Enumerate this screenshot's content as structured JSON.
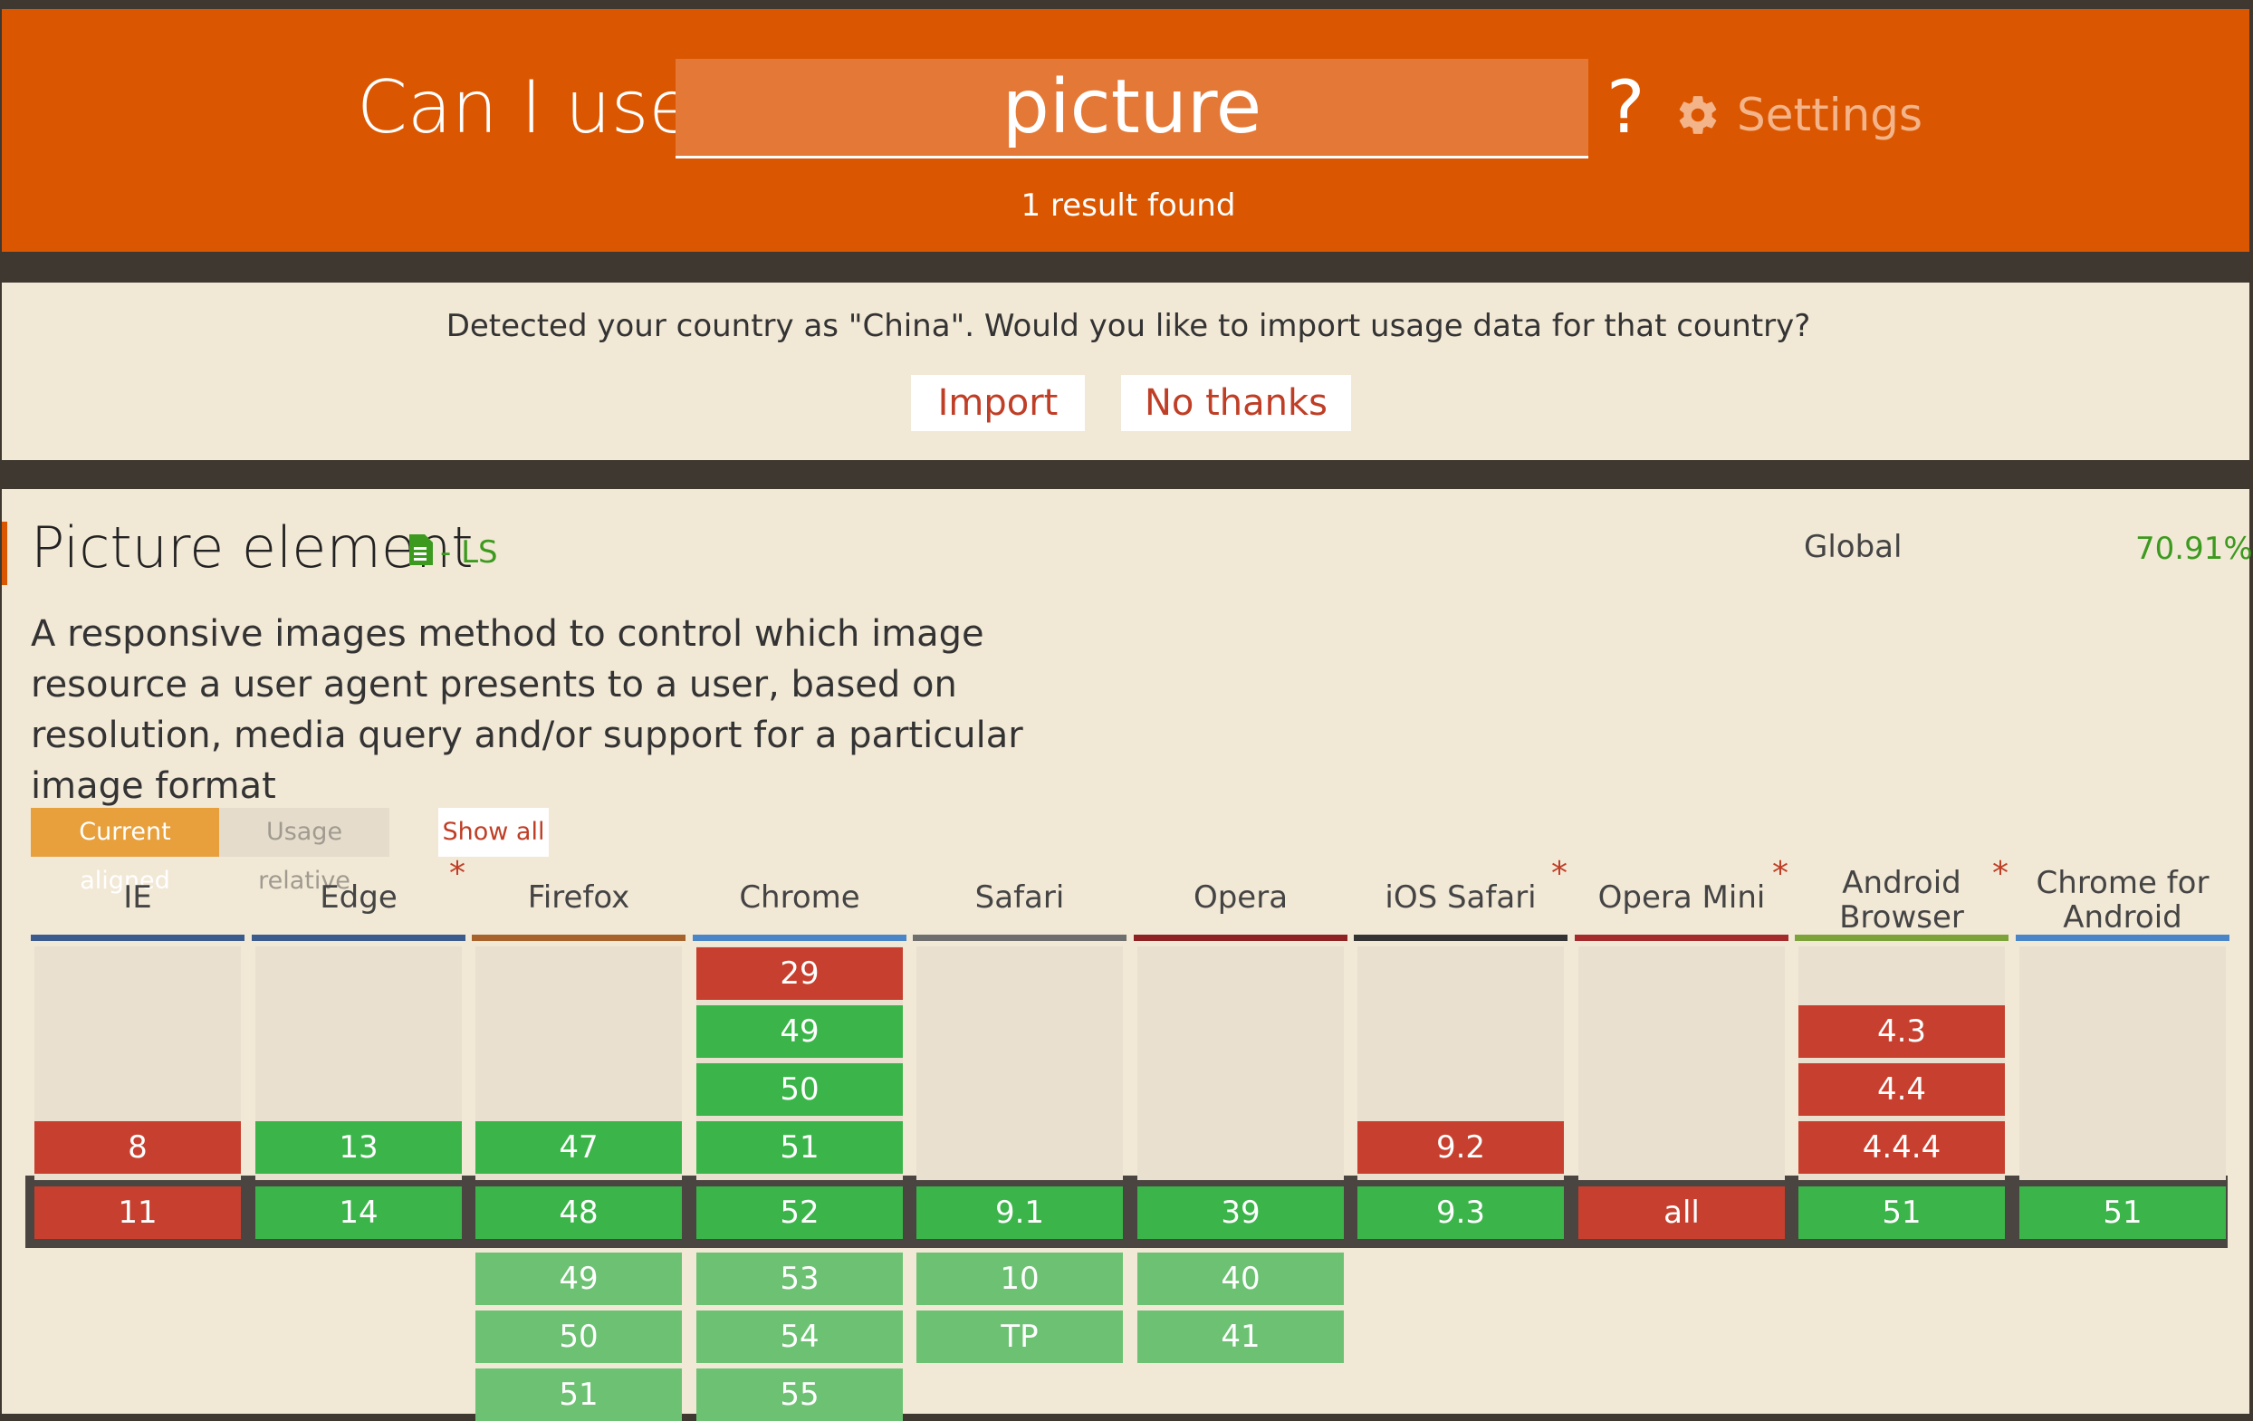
{
  "header": {
    "brand": "Can I use",
    "search_value": "picture",
    "question_mark": "?",
    "settings_label": "Settings",
    "result_count": "1 result found"
  },
  "notice": {
    "text": "Detected your country as \"China\". Would you like to import usage data for that country?",
    "import_label": "Import",
    "no_thanks_label": "No thanks"
  },
  "feature": {
    "title": "Picture element",
    "status": "- LS",
    "global_label": "Global",
    "global_value": "70.91%",
    "description": "A responsive images method to control which image resource a user agent presents to a user, based on resolution, media query and/or support for a particular image format"
  },
  "toggles": {
    "current_aligned": "Current aligned",
    "usage_relative": "Usage relative",
    "show_all": "Show all"
  },
  "colors": {
    "supported": "#3bb54a",
    "unsupported": "#c7402f",
    "future": "#6cc272",
    "brand": "#db5600"
  },
  "browsers": [
    {
      "name": "IE",
      "note": "",
      "bar_color": "#3b5b8c",
      "past": [
        {
          "v": "8",
          "s": "n"
        }
      ],
      "current": {
        "v": "11",
        "s": "n"
      },
      "future": []
    },
    {
      "name": "Edge",
      "note": "*",
      "bar_color": "#3b5b8c",
      "past": [
        {
          "v": "13",
          "s": "y"
        }
      ],
      "current": {
        "v": "14",
        "s": "y"
      },
      "future": []
    },
    {
      "name": "Firefox",
      "note": "",
      "bar_color": "#a6622a",
      "past": [
        {
          "v": "47",
          "s": "y"
        }
      ],
      "current": {
        "v": "48",
        "s": "y"
      },
      "future": [
        {
          "v": "49",
          "s": "f"
        },
        {
          "v": "50",
          "s": "f"
        },
        {
          "v": "51",
          "s": "f"
        }
      ]
    },
    {
      "name": "Chrome",
      "note": "",
      "bar_color": "#4a86c7",
      "past": [
        {
          "v": "29",
          "s": "n"
        },
        {
          "v": "49",
          "s": "y"
        },
        {
          "v": "50",
          "s": "y"
        },
        {
          "v": "51",
          "s": "y"
        }
      ],
      "current": {
        "v": "52",
        "s": "y"
      },
      "future": [
        {
          "v": "53",
          "s": "f"
        },
        {
          "v": "54",
          "s": "f"
        },
        {
          "v": "55",
          "s": "f"
        }
      ]
    },
    {
      "name": "Safari",
      "note": "",
      "bar_color": "#6e6e6e",
      "past": [],
      "current": {
        "v": "9.1",
        "s": "y"
      },
      "future": [
        {
          "v": "10",
          "s": "f"
        },
        {
          "v": "TP",
          "s": "f"
        }
      ]
    },
    {
      "name": "Opera",
      "note": "",
      "bar_color": "#8e2222",
      "past": [],
      "current": {
        "v": "39",
        "s": "y"
      },
      "future": [
        {
          "v": "40",
          "s": "f"
        },
        {
          "v": "41",
          "s": "f"
        }
      ]
    },
    {
      "name": "iOS Safari",
      "note": "*",
      "bar_color": "#333333",
      "past": [
        {
          "v": "9.2",
          "s": "n"
        }
      ],
      "current": {
        "v": "9.3",
        "s": "y"
      },
      "future": []
    },
    {
      "name": "Opera Mini",
      "note": "*",
      "bar_color": "#a32b2b",
      "past": [],
      "current": {
        "v": "all",
        "s": "n"
      },
      "future": []
    },
    {
      "name": "Android Browser",
      "note": "*",
      "bar_color": "#7ba33a",
      "past": [
        {
          "v": "4.3",
          "s": "n"
        },
        {
          "v": "4.4",
          "s": "n"
        },
        {
          "v": "4.4.4",
          "s": "n"
        }
      ],
      "current": {
        "v": "51",
        "s": "y"
      },
      "future": []
    },
    {
      "name": "Chrome for Android",
      "note": "",
      "bar_color": "#4a86c7",
      "past": [],
      "current": {
        "v": "51",
        "s": "y"
      },
      "future": []
    }
  ]
}
